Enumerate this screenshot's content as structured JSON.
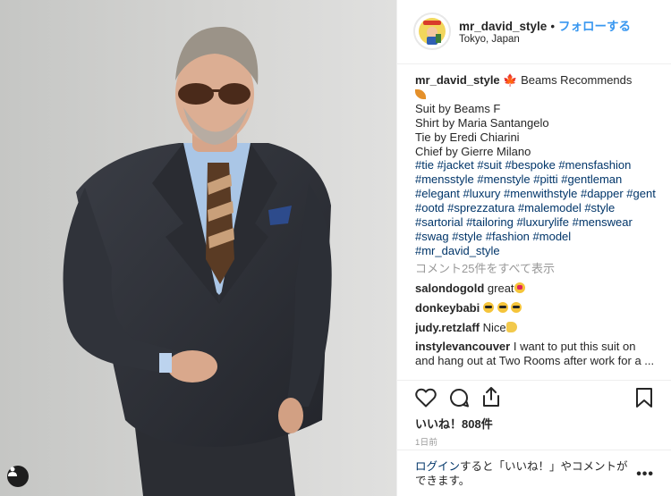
{
  "post": {
    "username": "mr_david_style",
    "separator": "•",
    "follow_label": "フォローする",
    "location": "Tokyo, Japan"
  },
  "caption": {
    "username": "mr_david_style",
    "headline": "Beams Recommends",
    "lines": [
      "Suit by Beams F",
      "Shirt by Maria Santangelo",
      "Tie by Eredi Chiarini",
      "Chief by Gierre Milano"
    ],
    "hashtags": "#tie #jacket #suit #bespoke #mensfashion #mensstyle #menstyle #pitti #gentleman #elegant #luxury #menwithstyle #dapper #gent #ootd #sprezzatura #malemodel #style #sartorial #tailoring #luxurylife #menswear #swag #style #fashion #model #mr_david_style"
  },
  "view_all_comments": "コメント25件をすべて表示",
  "comments": [
    {
      "user": "salondogold",
      "text": "great"
    },
    {
      "user": "donkeybabi",
      "text": ""
    },
    {
      "user": "judy.retzlaff",
      "text": "Nice"
    },
    {
      "user": "instylevancouver",
      "text": "I want to put this suit on and hang out at Two Rooms after work for a ..."
    }
  ],
  "likes": "いいね！808件",
  "timestamp": "1日前",
  "login": {
    "link": "ログイン",
    "text": "すると「いいね！」やコメントができます。"
  },
  "icons": {
    "heart": "heart-icon",
    "comment": "comment-icon",
    "share": "share-icon",
    "bookmark": "bookmark-icon",
    "more": "more-options-icon",
    "user_tag": "user-tag-icon"
  },
  "colors": {
    "link_blue": "#3897f0",
    "hashtag_navy": "#003569",
    "muted_gray": "#999999",
    "text": "#262626"
  }
}
